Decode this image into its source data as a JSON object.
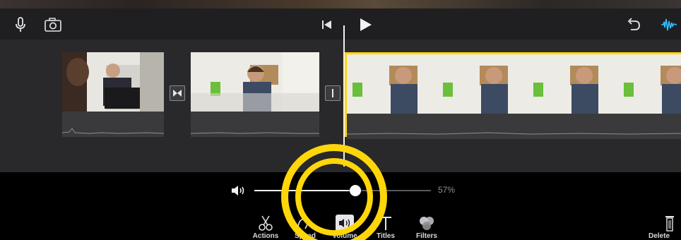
{
  "toolbar": {
    "icons": {
      "mic": "microphone-icon",
      "camera": "camera-icon",
      "skip_back": "skip-to-start-icon",
      "play": "play-icon",
      "undo": "undo-icon",
      "audio_wave": "audio-waveform-icon"
    }
  },
  "timeline": {
    "clips": [
      {
        "name": "wheelchair-interview-clip"
      },
      {
        "name": "man-speaking-clip"
      },
      {
        "name": "selected-man-speaking-clip",
        "selected": true
      }
    ]
  },
  "volume": {
    "icon": "speaker-icon",
    "value": 0.57,
    "percent_label": "57%"
  },
  "tools": [
    {
      "label": "Actions",
      "icon": "scissors-icon"
    },
    {
      "label": "Speed",
      "icon": "speed-icon"
    },
    {
      "label": "Volume",
      "icon": "volume-icon"
    },
    {
      "label": "Titles",
      "icon": "titles-icon"
    },
    {
      "label": "Filters",
      "icon": "filters-icon"
    },
    {
      "label": "Delete",
      "icon": "trash-icon"
    }
  ],
  "colors": {
    "selection": "#ffd60a",
    "accent_wave": "#2fc2ff",
    "background": "#1c1c1e"
  }
}
